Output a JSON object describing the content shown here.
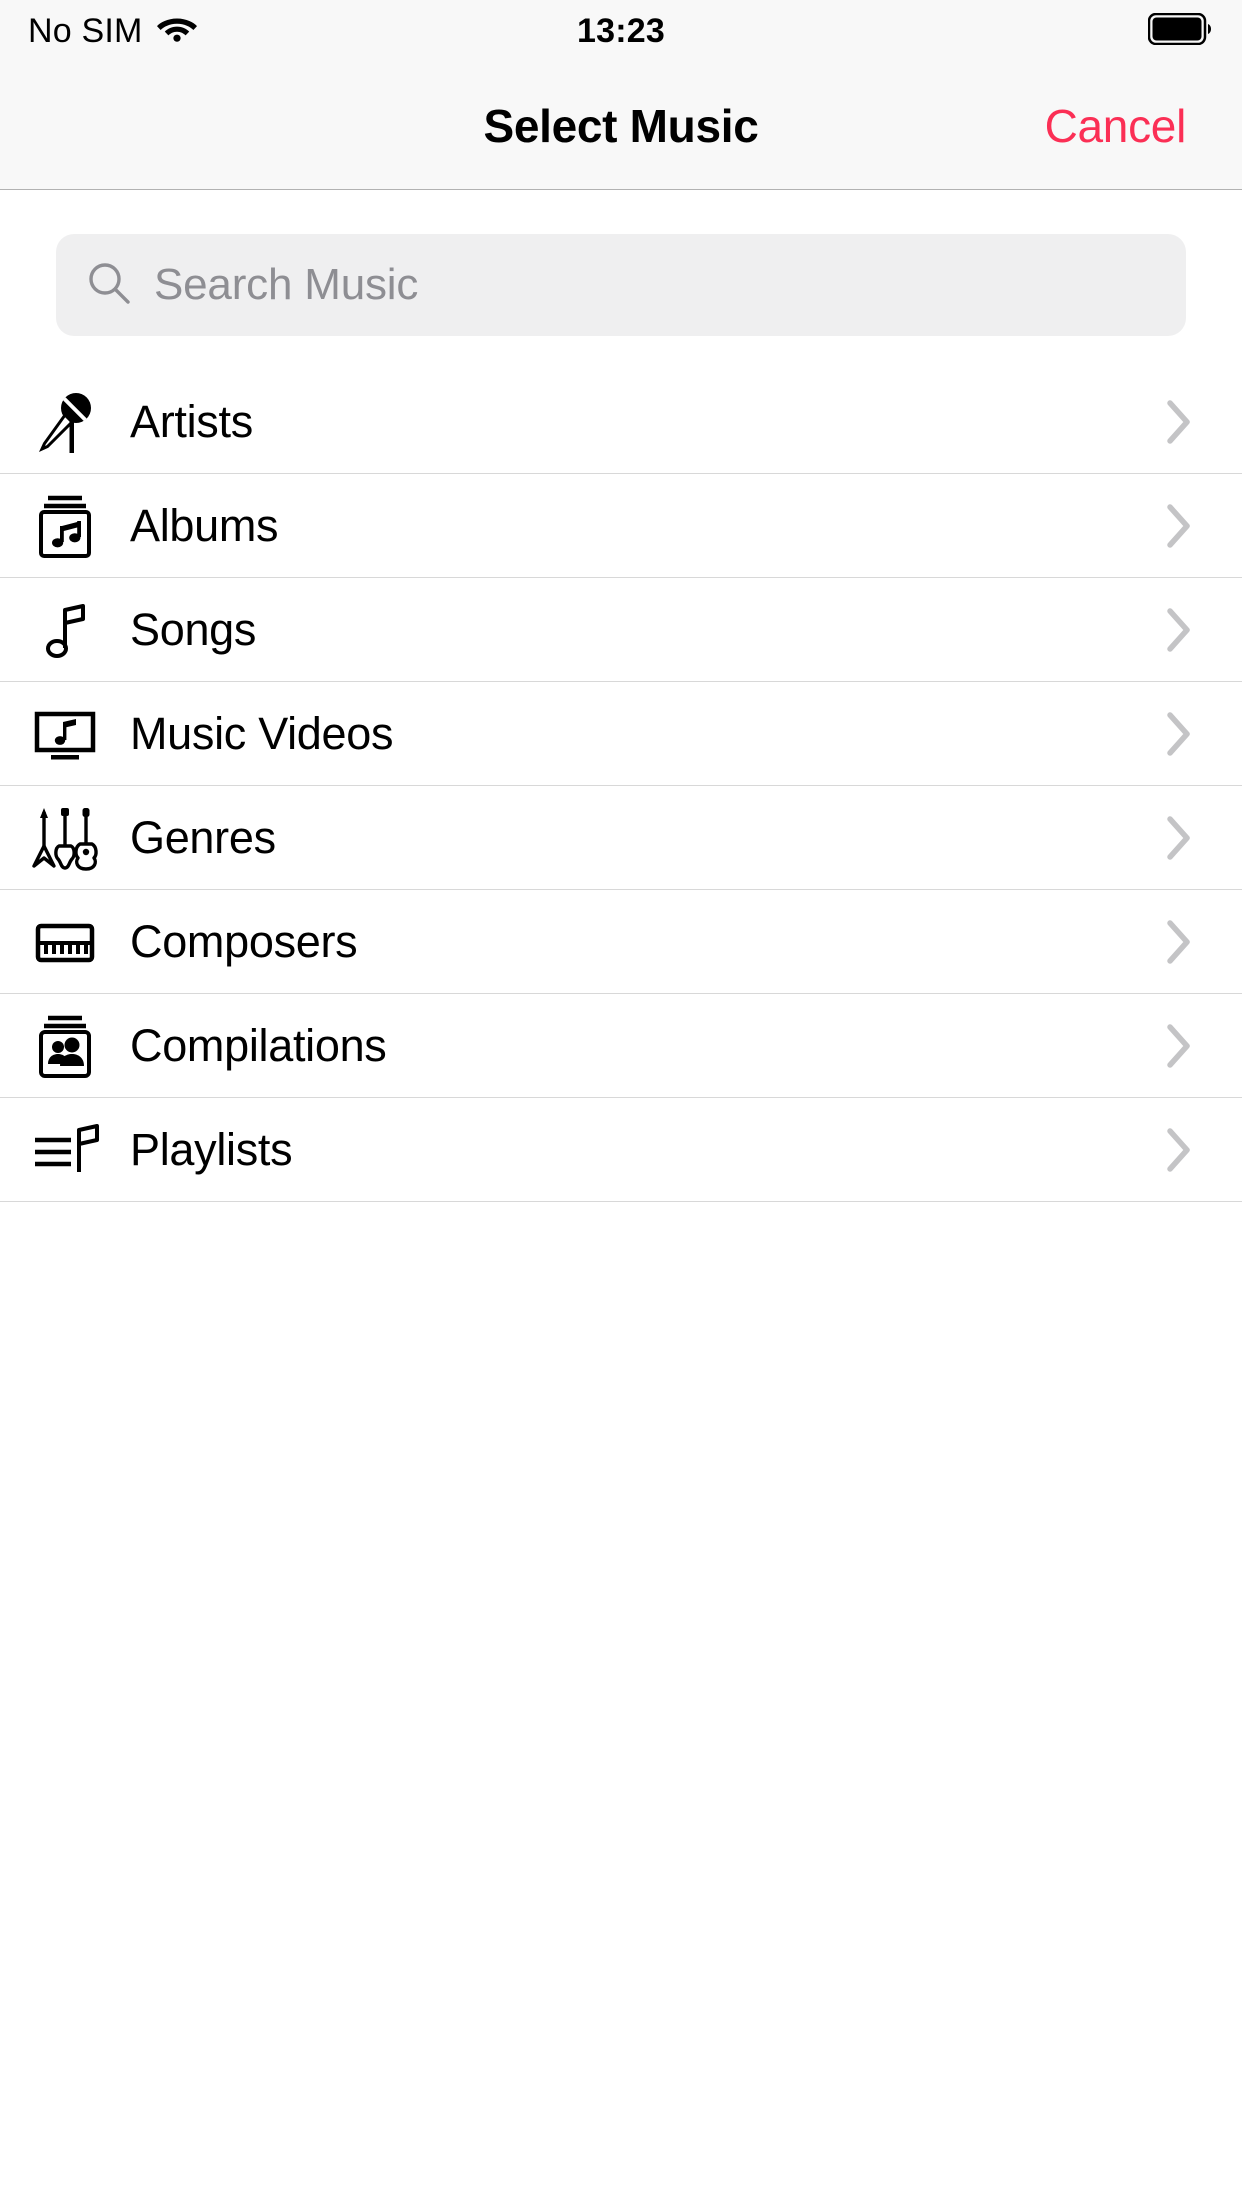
{
  "status_bar": {
    "carrier": "No SIM",
    "wifi_icon": "wifi-icon",
    "time": "13:23",
    "battery_icon": "battery-full-icon"
  },
  "nav_bar": {
    "title": "Select Music",
    "cancel_label": "Cancel",
    "cancel_color": "#FB2F55"
  },
  "search": {
    "placeholder": "Search Music",
    "icon": "search-icon",
    "value": ""
  },
  "list": {
    "chevron_icon": "chevron-right-icon",
    "items": [
      {
        "label": "Artists",
        "icon": "microphone-icon"
      },
      {
        "label": "Albums",
        "icon": "album-stack-icon"
      },
      {
        "label": "Songs",
        "icon": "music-note-icon"
      },
      {
        "label": "Music Videos",
        "icon": "tv-music-note-icon"
      },
      {
        "label": "Genres",
        "icon": "guitars-icon"
      },
      {
        "label": "Composers",
        "icon": "piano-keyboard-icon"
      },
      {
        "label": "Compilations",
        "icon": "people-stack-icon"
      },
      {
        "label": "Playlists",
        "icon": "playlist-note-icon"
      }
    ]
  }
}
